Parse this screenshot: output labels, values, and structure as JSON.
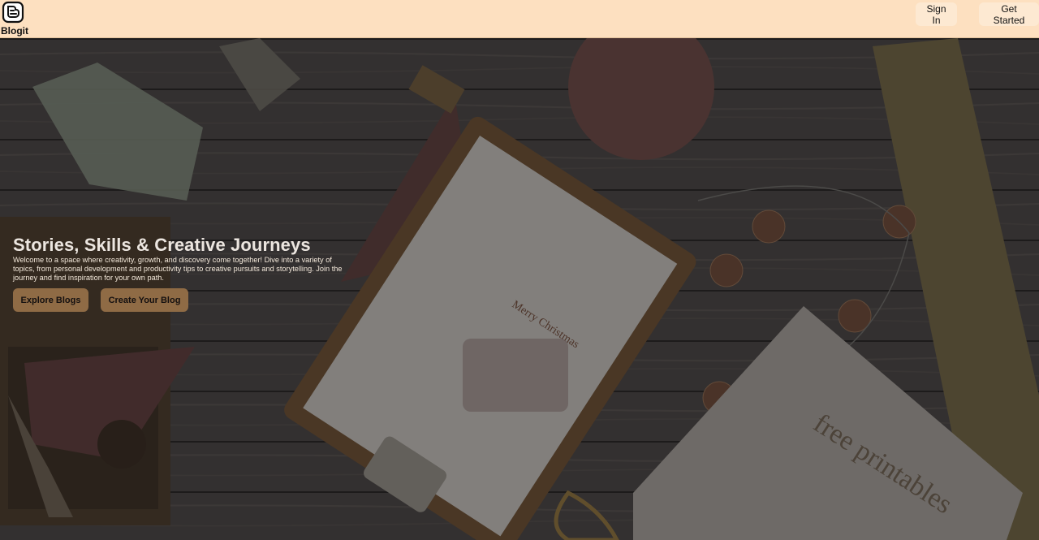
{
  "brand": {
    "name": "Blogit",
    "logo_icon": "blogger-b-icon"
  },
  "header": {
    "sign_in_label": "Sign In",
    "get_started_label": "Get Started"
  },
  "hero": {
    "title": "Stories, Skills & Creative Journeys",
    "description": "Welcome to a space where creativity, growth, and discovery come together! Dive into a variety of topics, from personal development and productivity tips to creative pursuits and storytelling. Join the journey and find inspiration for your own path.",
    "explore_label": "Explore Blogs",
    "create_label": "Create Your Blog",
    "printable_lettering": "free printables",
    "card_lettering": "Merry Christmas"
  },
  "colors": {
    "header_bg": "#fde0c0",
    "button_bg": "#fde9d2",
    "cta_bg": "#8f6b45"
  }
}
